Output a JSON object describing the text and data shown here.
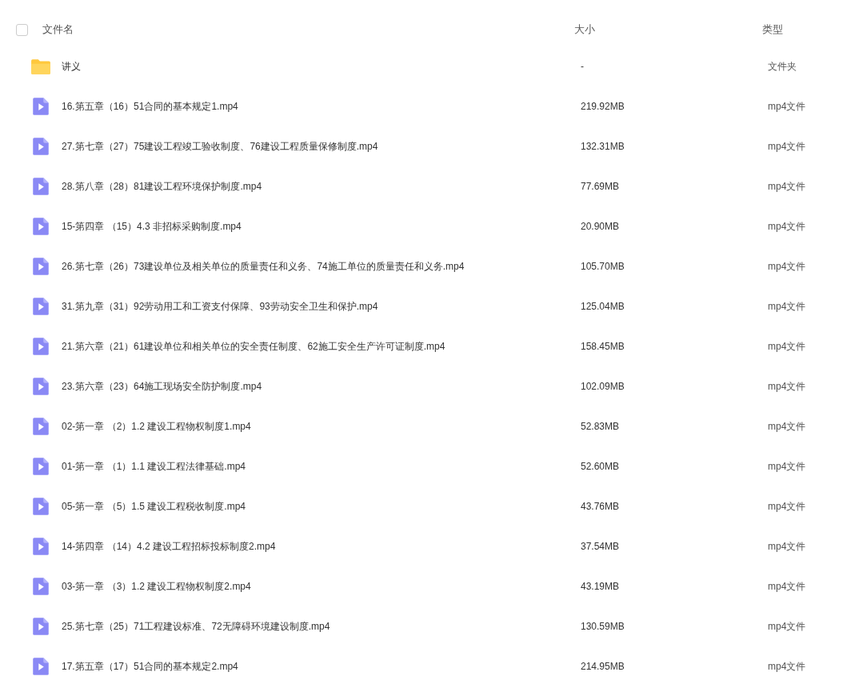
{
  "table": {
    "select_all": {
      "checked": false
    },
    "columns": [
      "文件名",
      "大小",
      "类型"
    ],
    "rows": [
      {
        "kind": "folder",
        "name": "讲义",
        "size": "-",
        "type": "文件夹"
      },
      {
        "kind": "video",
        "name": "16.第五章（16）51合同的基本规定1.mp4",
        "size": "219.92MB",
        "type": "mp4文件"
      },
      {
        "kind": "video",
        "name": "27.第七章（27）75建设工程竣工验收制度、76建设工程质量保修制度.mp4",
        "size": "132.31MB",
        "type": "mp4文件"
      },
      {
        "kind": "video",
        "name": "28.第八章（28）81建设工程环境保护制度.mp4",
        "size": "77.69MB",
        "type": "mp4文件"
      },
      {
        "kind": "video",
        "name": "15-第四章 （15）4.3 非招标采购制度.mp4",
        "size": "20.90MB",
        "type": "mp4文件"
      },
      {
        "kind": "video",
        "name": "26.第七章（26）73建设单位及相关单位的质量责任和义务、74施工单位的质量责任和义务.mp4",
        "size": "105.70MB",
        "type": "mp4文件"
      },
      {
        "kind": "video",
        "name": "31.第九章（31）92劳动用工和工资支付保障、93劳动安全卫生和保护.mp4",
        "size": "125.04MB",
        "type": "mp4文件"
      },
      {
        "kind": "video",
        "name": "21.第六章（21）61建设单位和相关单位的安全责任制度、62施工安全生产许可证制度.mp4",
        "size": "158.45MB",
        "type": "mp4文件"
      },
      {
        "kind": "video",
        "name": "23.第六章（23）64施工现场安全防护制度.mp4",
        "size": "102.09MB",
        "type": "mp4文件"
      },
      {
        "kind": "video",
        "name": "02-第一章 （2）1.2 建设工程物权制度1.mp4",
        "size": "52.83MB",
        "type": "mp4文件"
      },
      {
        "kind": "video",
        "name": "01-第一章 （1）1.1 建设工程法律基础.mp4",
        "size": "52.60MB",
        "type": "mp4文件"
      },
      {
        "kind": "video",
        "name": "05-第一章 （5）1.5 建设工程税收制度.mp4",
        "size": "43.76MB",
        "type": "mp4文件"
      },
      {
        "kind": "video",
        "name": "14-第四章 （14）4.2 建设工程招标投标制度2.mp4",
        "size": "37.54MB",
        "type": "mp4文件"
      },
      {
        "kind": "video",
        "name": "03-第一章 （3）1.2 建设工程物权制度2.mp4",
        "size": "43.19MB",
        "type": "mp4文件"
      },
      {
        "kind": "video",
        "name": "25.第七章（25）71工程建设标准、72无障碍环境建设制度.mp4",
        "size": "130.59MB",
        "type": "mp4文件"
      },
      {
        "kind": "video",
        "name": "17.第五章（17）51合同的基本规定2.mp4",
        "size": "214.95MB",
        "type": "mp4文件"
      }
    ]
  }
}
